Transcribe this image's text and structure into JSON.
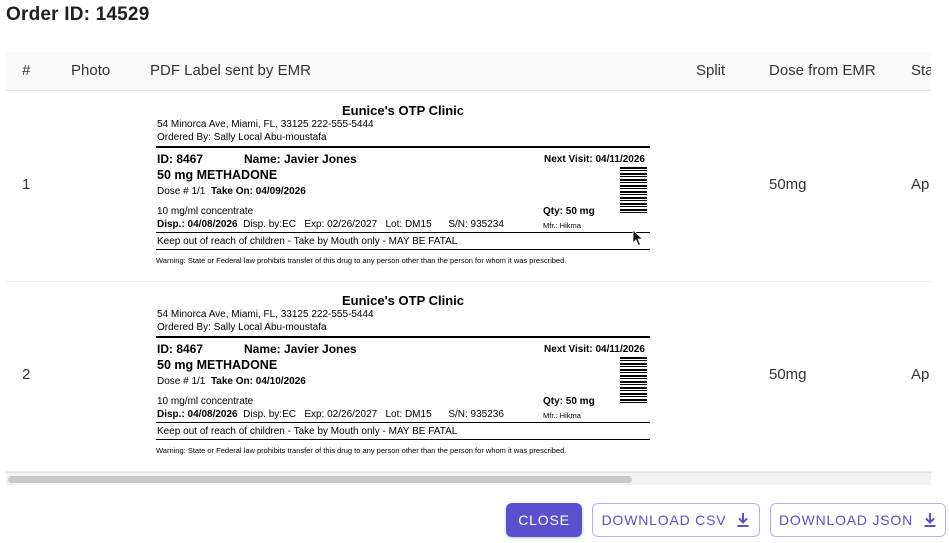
{
  "header": {
    "title": "Order ID: 14529"
  },
  "table": {
    "columns": [
      "#",
      "Photo",
      "PDF Label sent by EMR",
      "Split",
      "Dose from EMR",
      "Sta"
    ],
    "rows": [
      {
        "index": "1",
        "dose_from_emr": "50mg",
        "status": "Ap",
        "label": {
          "clinic": "Eunice's OTP Clinic",
          "address": "54 Minorca Ave, Miami, FL, 33125 222-555-5444",
          "ordered_by": "Ordered By: Sally Local Abu-moustafa",
          "id": "ID: 8467",
          "name": "Name: Javier Jones",
          "next_visit": "Next Visit: 04/11/2026",
          "drug": "50 mg METHADONE",
          "dose_no": "Dose # 1/1",
          "take_on": "Take On: 04/09/2026",
          "concentration": "10 mg/ml concentrate",
          "qty": "Qty: 50 mg",
          "disp_date": "Disp.: 04/08/2026",
          "disp_by": "Disp. by:EC",
          "exp": "Exp: 02/26/2027",
          "lot": "Lot: DM15",
          "sn": "S/N: 935234",
          "mfr": "Mfr.: Hikma",
          "keep_out": "Keep out of reach of children - Take by Mouth only - MAY BE FATAL",
          "warning": "Warning: State or Federal law prohibits transfer of this drug to any person other than the person for whom it was prescribed."
        }
      },
      {
        "index": "2",
        "dose_from_emr": "50mg",
        "status": "Ap",
        "label": {
          "clinic": "Eunice's OTP Clinic",
          "address": "54 Minorca Ave, Miami, FL, 33125 222-555-5444",
          "ordered_by": "Ordered By: Sally Local Abu-moustafa",
          "id": "ID: 8467",
          "name": "Name: Javier Jones",
          "next_visit": "Next Visit: 04/11/2026",
          "drug": "50 mg METHADONE",
          "dose_no": "Dose # 1/1",
          "take_on": "Take On: 04/10/2026",
          "concentration": "10 mg/ml concentrate",
          "qty": "Qty: 50 mg",
          "disp_date": "Disp.: 04/08/2026",
          "disp_by": "Disp. by:EC",
          "exp": "Exp: 02/26/2027",
          "lot": "Lot: DM15",
          "sn": "S/N: 935236",
          "mfr": "Mfr.: Hikma",
          "keep_out": "Keep out of reach of children - Take by Mouth only - MAY BE FATAL",
          "warning": "Warning: State or Federal law prohibits transfer of this drug to any person other than the person for whom it was prescribed."
        }
      }
    ]
  },
  "footer": {
    "close_label": "CLOSE",
    "download_csv_label": "DOWNLOAD CSV",
    "download_json_label": "DOWNLOAD JSON"
  },
  "icons": {
    "download": "download-icon",
    "cursor": "mouse-pointer-icon"
  },
  "colors": {
    "accent": "#5b4fcf",
    "accent_border": "#b7b1ea"
  }
}
